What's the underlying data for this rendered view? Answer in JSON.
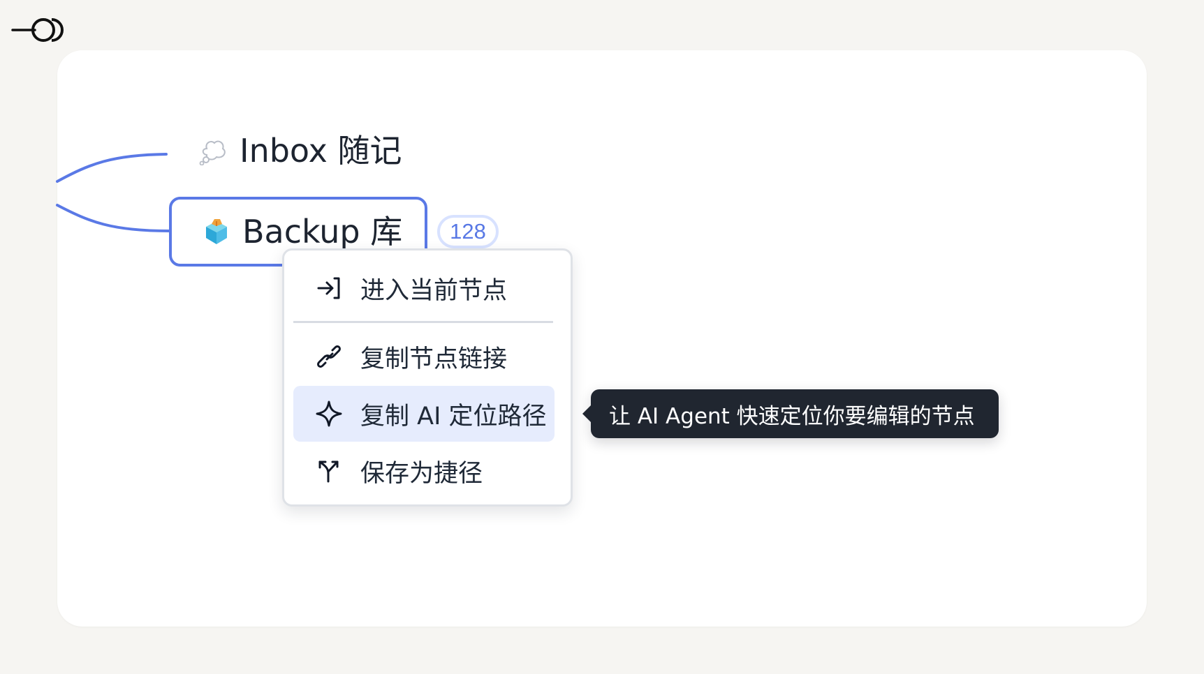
{
  "colors": {
    "page_background": "#f6f5f2",
    "card_background": "#ffffff",
    "accent": "#5a79e6",
    "badge_text": "#5878e5",
    "menu_highlight": "#e6ecfd",
    "tooltip_background": "#202630",
    "text": "#1f2937"
  },
  "logo": {
    "icon": "link-toggle-logo-icon"
  },
  "mindmap": {
    "nodes": [
      {
        "label": "Inbox 随记",
        "icon": "thought-bubble-icon",
        "selected": false
      },
      {
        "label": "Backup 库",
        "icon": "cube-box-icon",
        "selected": true,
        "count": "128"
      }
    ]
  },
  "context_menu": {
    "items": [
      {
        "label": "进入当前节点",
        "icon": "enter-arrow-icon",
        "active": false
      },
      {
        "label": "复制节点链接",
        "icon": "link-icon",
        "active": false
      },
      {
        "label": "复制 AI 定位路径",
        "icon": "sparkle-icon",
        "active": true
      },
      {
        "label": "保存为捷径",
        "icon": "branch-arrow-icon",
        "active": false
      }
    ]
  },
  "tooltip": {
    "text": "让 AI Agent 快速定位你要编辑的节点"
  }
}
